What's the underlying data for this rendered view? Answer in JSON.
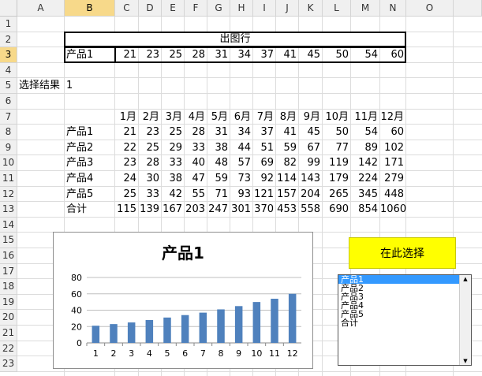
{
  "columns": [
    "A",
    "B",
    "C",
    "D",
    "E",
    "F",
    "G",
    "H",
    "I",
    "J",
    "K",
    "L",
    "M",
    "N",
    "O"
  ],
  "selected_column": "B",
  "rows": [
    "1",
    "2",
    "3",
    "4",
    "5",
    "6",
    "7",
    "8",
    "9",
    "10",
    "11",
    "12",
    "13",
    "14",
    "15",
    "16",
    "17",
    "18",
    "19",
    "20",
    "21",
    "22",
    "23"
  ],
  "selected_row": "3",
  "title_row": {
    "label": "出图行"
  },
  "output_row": {
    "name": "产品1",
    "values": [
      "21",
      "23",
      "25",
      "28",
      "31",
      "34",
      "37",
      "41",
      "45",
      "50",
      "54",
      "60"
    ]
  },
  "selection": {
    "label": "选择结果",
    "value": "1"
  },
  "table": {
    "months": [
      "1月",
      "2月",
      "3月",
      "4月",
      "5月",
      "6月",
      "7月",
      "8月",
      "9月",
      "10月",
      "11月",
      "12月"
    ],
    "rows": [
      {
        "name": "产品1",
        "values": [
          "21",
          "23",
          "25",
          "28",
          "31",
          "34",
          "37",
          "41",
          "45",
          "50",
          "54",
          "60"
        ]
      },
      {
        "name": "产品2",
        "values": [
          "22",
          "25",
          "29",
          "33",
          "38",
          "44",
          "51",
          "59",
          "67",
          "77",
          "89",
          "102"
        ]
      },
      {
        "name": "产品3",
        "values": [
          "23",
          "28",
          "33",
          "40",
          "48",
          "57",
          "69",
          "82",
          "99",
          "119",
          "142",
          "171"
        ]
      },
      {
        "name": "产品4",
        "values": [
          "24",
          "30",
          "38",
          "47",
          "59",
          "73",
          "92",
          "114",
          "143",
          "179",
          "224",
          "279"
        ]
      },
      {
        "name": "产品5",
        "values": [
          "25",
          "33",
          "42",
          "55",
          "71",
          "93",
          "121",
          "157",
          "204",
          "265",
          "345",
          "448"
        ]
      },
      {
        "name": "合计",
        "values": [
          "115",
          "139",
          "167",
          "203",
          "247",
          "301",
          "370",
          "453",
          "558",
          "690",
          "854",
          "1060"
        ]
      }
    ]
  },
  "chart_data": {
    "type": "bar",
    "title": "产品1",
    "categories": [
      "1",
      "2",
      "3",
      "4",
      "5",
      "6",
      "7",
      "8",
      "9",
      "10",
      "11",
      "12"
    ],
    "values": [
      21,
      23,
      25,
      28,
      31,
      34,
      37,
      41,
      45,
      50,
      54,
      60
    ],
    "y_ticks": [
      "0",
      "20",
      "40",
      "60",
      "80"
    ],
    "ylim": [
      0,
      80
    ],
    "grid": true,
    "bar_color": "#4f81bd"
  },
  "button": {
    "label": "在此选择",
    "color": "#ffff00"
  },
  "listbox": {
    "items": [
      "产品1",
      "产品2",
      "产品3",
      "产品4",
      "产品5",
      "合计"
    ],
    "selected_index": 0
  }
}
